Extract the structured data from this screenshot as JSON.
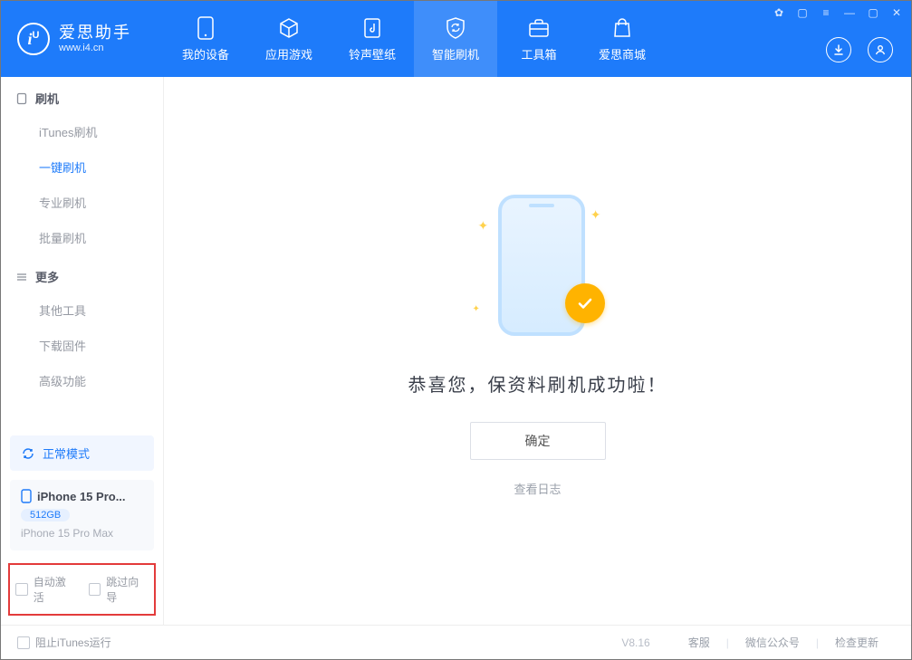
{
  "brand": {
    "title": "爱思助手",
    "subtitle": "www.i4.cn"
  },
  "nav": {
    "items": [
      {
        "label": "我的设备"
      },
      {
        "label": "应用游戏"
      },
      {
        "label": "铃声壁纸"
      },
      {
        "label": "智能刷机"
      },
      {
        "label": "工具箱"
      },
      {
        "label": "爱思商城"
      }
    ],
    "active_index": 3
  },
  "sidebar": {
    "section1": {
      "title": "刷机",
      "items": [
        "iTunes刷机",
        "一键刷机",
        "专业刷机",
        "批量刷机"
      ],
      "active_index": 1
    },
    "section2": {
      "title": "更多",
      "items": [
        "其他工具",
        "下载固件",
        "高级功能"
      ]
    },
    "device_mode": "正常模式",
    "device": {
      "name": "iPhone 15 Pro...",
      "storage": "512GB",
      "full": "iPhone 15 Pro Max"
    },
    "highlight": {
      "auto_activate": "自动激活",
      "skip_guide": "跳过向导"
    }
  },
  "main": {
    "success_text": "恭喜您，保资料刷机成功啦！",
    "ok_button": "确定",
    "view_log": "查看日志"
  },
  "footer": {
    "block_itunes": "阻止iTunes运行",
    "version": "V8.16",
    "links": [
      "客服",
      "微信公众号",
      "检查更新"
    ]
  }
}
